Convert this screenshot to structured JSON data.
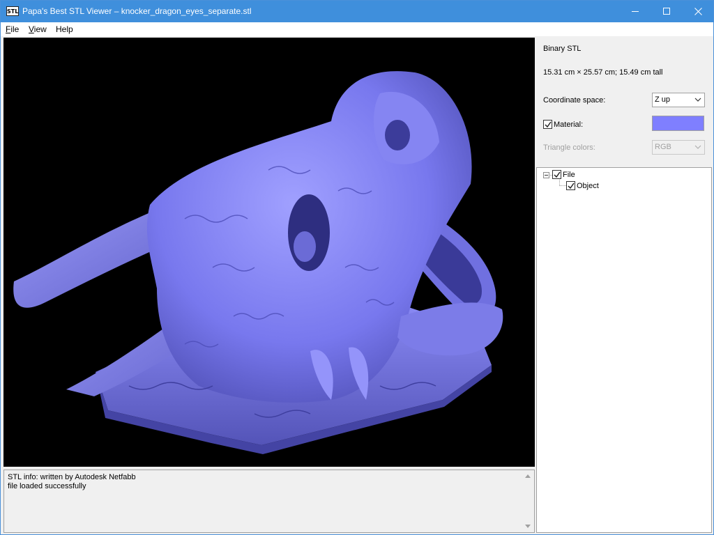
{
  "window": {
    "title": "Papa's Best STL Viewer – knocker_dragon_eyes_separate.stl",
    "icon_text": "STL",
    "icons": {
      "minimize": "minimize-icon",
      "maximize": "maximize-icon",
      "close": "close-icon"
    }
  },
  "menu": {
    "file": {
      "key": "F",
      "rest": "ile"
    },
    "view": {
      "key": "V",
      "rest": "iew"
    },
    "help": {
      "label": "Help"
    }
  },
  "viewport": {
    "background": "#000000",
    "model_color": "#7f7fff",
    "model_description": "dragon skull door knocker"
  },
  "log": {
    "lines": "STL info: written by Autodesk Netfabb\nfile loaded successfully"
  },
  "side": {
    "file_type": "Binary STL",
    "dimensions": "15.31 cm × 25.57 cm; 15.49 cm tall",
    "coordinate_label": "Coordinate space:",
    "coordinate_value": "Z up",
    "material_label": "Material:",
    "material_checked": true,
    "material_color": "#7f7fff",
    "triangle_label": "Triangle colors:",
    "triangle_value": "RGB"
  },
  "tree": {
    "root": {
      "label": "File",
      "checked": true,
      "expanded": true
    },
    "child": {
      "label": "Object",
      "checked": true
    }
  }
}
